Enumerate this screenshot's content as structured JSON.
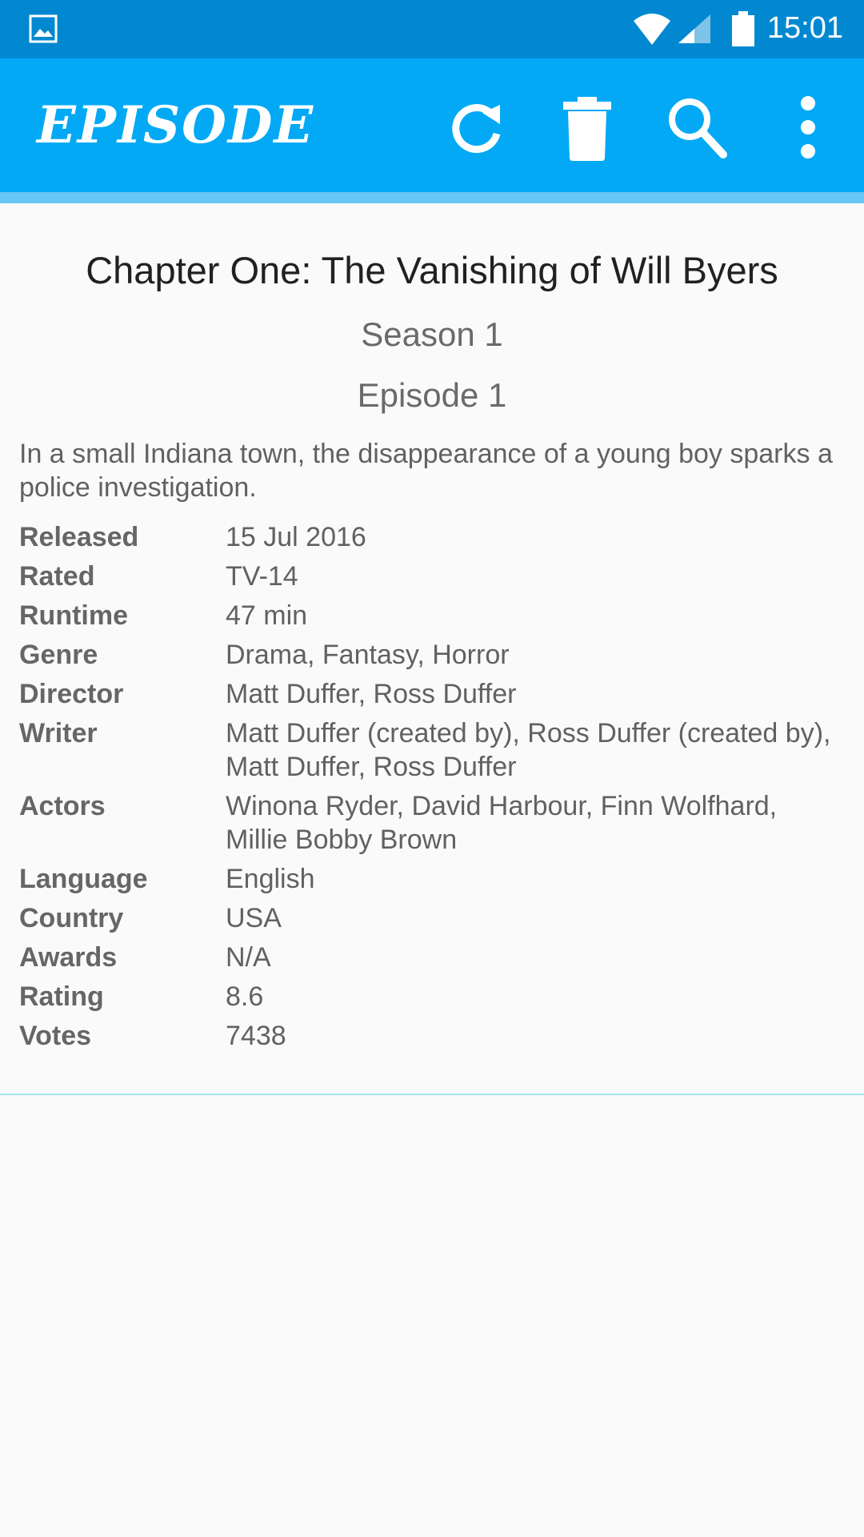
{
  "status_bar": {
    "time": "15:01"
  },
  "app_bar": {
    "title": "EPISODE",
    "actions": [
      "refresh-icon",
      "delete-icon",
      "search-icon",
      "more-vert-icon"
    ]
  },
  "episode": {
    "title": "Chapter One: The Vanishing of Will Byers",
    "season": "Season 1",
    "episode": "Episode 1",
    "plot": "In a small Indiana town, the disappearance of a young boy sparks a police investigation."
  },
  "details": [
    {
      "label": "Released",
      "value": "15 Jul 2016"
    },
    {
      "label": "Rated",
      "value": "TV-14"
    },
    {
      "label": "Runtime",
      "value": "47 min"
    },
    {
      "label": "Genre",
      "value": "Drama, Fantasy, Horror"
    },
    {
      "label": "Director",
      "value": "Matt Duffer, Ross Duffer"
    },
    {
      "label": "Writer",
      "value": "Matt Duffer (created by), Ross Duffer (created by), Matt Duffer, Ross Duffer"
    },
    {
      "label": "Actors",
      "value": "Winona Ryder, David Harbour, Finn Wolfhard, Millie Bobby Brown"
    },
    {
      "label": "Language",
      "value": "English"
    },
    {
      "label": "Country",
      "value": "USA"
    },
    {
      "label": "Awards",
      "value": "N/A"
    },
    {
      "label": "Rating",
      "value": "8.6"
    },
    {
      "label": "Votes",
      "value": "7438"
    }
  ],
  "colors": {
    "status_bar": "#0288d1",
    "app_bar": "#03a9f4",
    "background": "#fafafa"
  }
}
